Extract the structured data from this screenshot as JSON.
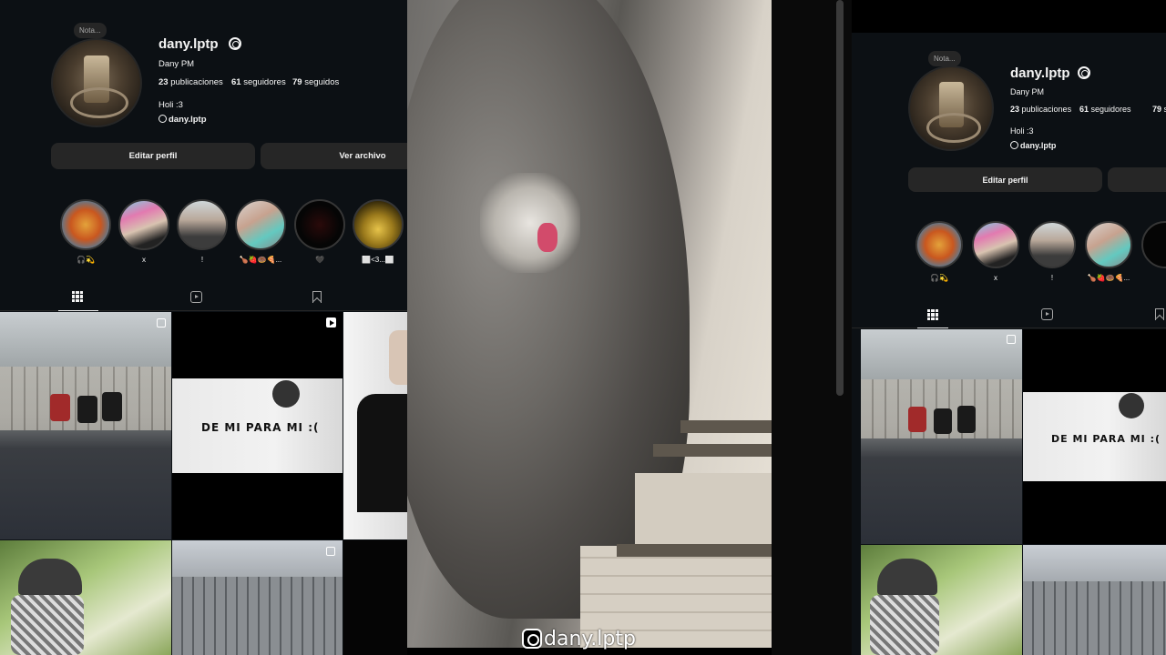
{
  "profile_left": {
    "note": "Nota...",
    "username": "dany.lptp",
    "full_name": "Dany PM",
    "stats": [
      {
        "count": "23",
        "label": "publicaciones"
      },
      {
        "count": "61",
        "label": "seguidores"
      },
      {
        "count": "79",
        "label": "seguidos"
      }
    ],
    "bio": "Holi :3",
    "threads_handle": "dany.lptp",
    "edit_button": "Editar perfil",
    "archive_button": "Ver archivo",
    "stories": [
      {
        "label": "🎧💫"
      },
      {
        "label": "x"
      },
      {
        "label": "!"
      },
      {
        "label": "🍗🍓🍩🍕..."
      },
      {
        "label": "🖤"
      },
      {
        "label": "⬜<3...⬜"
      }
    ],
    "post_caption": "DE MI PARA MI :("
  },
  "video": {
    "watermark": "dany.lptp"
  },
  "profile_right": {
    "note": "Nota...",
    "username": "dany.lptp",
    "full_name": "Dany PM",
    "stats": [
      {
        "count": "23",
        "label": "publicaciones"
      },
      {
        "count": "61",
        "label": "seguidores"
      },
      {
        "count": "79",
        "label": "seguidos"
      }
    ],
    "bio": "Holi :3",
    "threads_handle": "dany.lptp",
    "edit_button": "Editar perfil",
    "stories": [
      {
        "label": "🎧💫"
      },
      {
        "label": "x"
      },
      {
        "label": "!"
      },
      {
        "label": "🍗🍓🍩🍕..."
      }
    ],
    "post_caption": "DE MI PARA MI :("
  },
  "colors": {
    "background": "#0c1014",
    "button": "#262626",
    "text": "#f5f5f5"
  }
}
